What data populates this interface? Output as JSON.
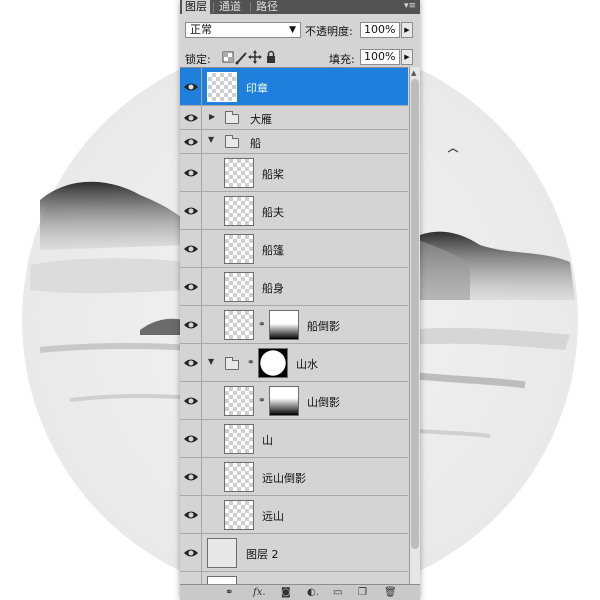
{
  "panel": {
    "tabs": [
      "图层",
      "通道",
      "路径"
    ],
    "menu_icon": "panel-menu-icon",
    "blend_mode": "正常",
    "opacity_label": "不透明度:",
    "opacity_value": "100%",
    "lock_label": "锁定:",
    "fill_label": "填充:",
    "fill_value": "100%"
  },
  "layers": [
    {
      "name": "印章",
      "type": "layer",
      "selected": true
    },
    {
      "name": "大雁",
      "type": "group",
      "expanded": false
    },
    {
      "name": "船",
      "type": "group",
      "expanded": true
    },
    {
      "name": "船桨",
      "type": "layer",
      "indent": true
    },
    {
      "name": "船夫",
      "type": "layer",
      "indent": true
    },
    {
      "name": "船篷",
      "type": "layer",
      "indent": true
    },
    {
      "name": "船身",
      "type": "layer",
      "indent": true
    },
    {
      "name": "船倒影",
      "type": "layer",
      "indent": true,
      "mask": true
    },
    {
      "name": "山水",
      "type": "group",
      "expanded": true,
      "mask": true
    },
    {
      "name": "山倒影",
      "type": "layer",
      "indent": true,
      "mask": true
    },
    {
      "name": "山",
      "type": "layer",
      "indent": true
    },
    {
      "name": "远山倒影",
      "type": "layer",
      "indent": true
    },
    {
      "name": "远山",
      "type": "layer",
      "indent": true
    },
    {
      "name": "图层 2",
      "type": "layer"
    },
    {
      "name": "背景",
      "type": "layer"
    }
  ],
  "footer_icons": [
    "link-layers-icon",
    "fx-icon",
    "add-mask-icon",
    "adjustment-icon",
    "new-group-icon",
    "new-layer-icon",
    "delete-icon"
  ],
  "colors": {
    "panel_bg": "#d4d4d4",
    "selected": "#1f7fdc",
    "tabbar": "#535353"
  }
}
